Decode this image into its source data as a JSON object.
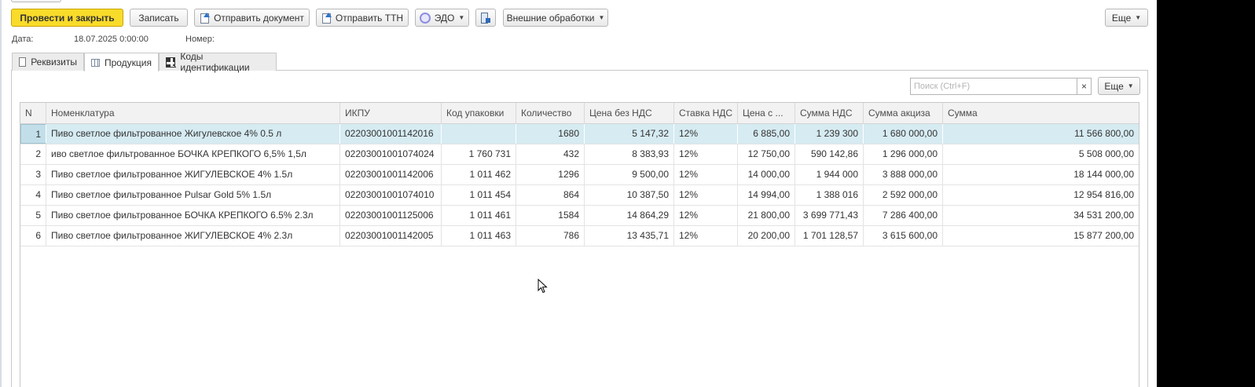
{
  "toolbar": {
    "post_close": "Провести и закрыть",
    "save": "Записать",
    "send_doc": "Отправить документ",
    "send_ttn": "Отправить ТТН",
    "edo": "ЭДО",
    "external": "Внешние обработки",
    "more": "Еще"
  },
  "header": {
    "date_label": "Дата:",
    "date_value": "18.07.2025 0:00:00",
    "number_label": "Номер:"
  },
  "tabs": [
    {
      "label": "Реквизиты"
    },
    {
      "label": "Продукция"
    },
    {
      "label": "Коды идентификации"
    }
  ],
  "table_toolbar": {
    "search_placeholder": "Поиск (Ctrl+F)",
    "clear": "×",
    "more": "Еще"
  },
  "table": {
    "columns": [
      "N",
      "Номенклатура",
      "ИКПУ",
      "Код упаковки",
      "Количество",
      "Цена без НДС",
      "Ставка НДС",
      "Цена с ...",
      "Сумма НДС",
      "Сумма акциза",
      "Сумма"
    ],
    "rows": [
      [
        "1",
        "Пиво светлое фильтрованное Жигулевское 4% 0.5 л",
        "02203001001142016",
        "",
        "1680",
        "5 147,32",
        "12%",
        "6 885,00",
        "1 239 300",
        "1 680 000,00",
        "11 566 800,00"
      ],
      [
        "2",
        "иво светлое фильтрованное БОЧКА КРЕПКОГО 6,5% 1,5л",
        "02203001001074024",
        "1 760 731",
        "432",
        "8 383,93",
        "12%",
        "12 750,00",
        "590 142,86",
        "1 296 000,00",
        "5 508 000,00"
      ],
      [
        "3",
        "Пиво светлое фильтрованное ЖИГУЛЕВСКОЕ 4% 1.5л",
        "02203001001142006",
        "1 011 462",
        "1296",
        "9 500,00",
        "12%",
        "14 000,00",
        "1 944 000",
        "3 888 000,00",
        "18 144 000,00"
      ],
      [
        "4",
        "Пиво светлое фильтрованное Pulsar Gold 5%  1.5л",
        "02203001001074010",
        "1 011 454",
        "864",
        "10 387,50",
        "12%",
        "14 994,00",
        "1 388 016",
        "2 592 000,00",
        "12 954 816,00"
      ],
      [
        "5",
        "Пиво светлое фильтрованное БОЧКА КРЕПКОГО  6.5% 2.3л",
        "02203001001125006",
        "1 011 461",
        "1584",
        "14 864,29",
        "12%",
        "21 800,00",
        "3 699 771,43",
        "7 286 400,00",
        "34 531 200,00"
      ],
      [
        "6",
        "Пиво светлое фильтрованное ЖИГУЛЕВСКОЕ 4% 2.3л",
        "02203001001142005",
        "1 011 463",
        "786",
        "13 435,71",
        "12%",
        "20 200,00",
        "1 701 128,57",
        "3 615 600,00",
        "15 877 200,00"
      ]
    ]
  },
  "colors": {
    "primary_button": "#f9db2a",
    "selected_row": "#d6ebf2",
    "header_bg": "#f2f2f2"
  }
}
